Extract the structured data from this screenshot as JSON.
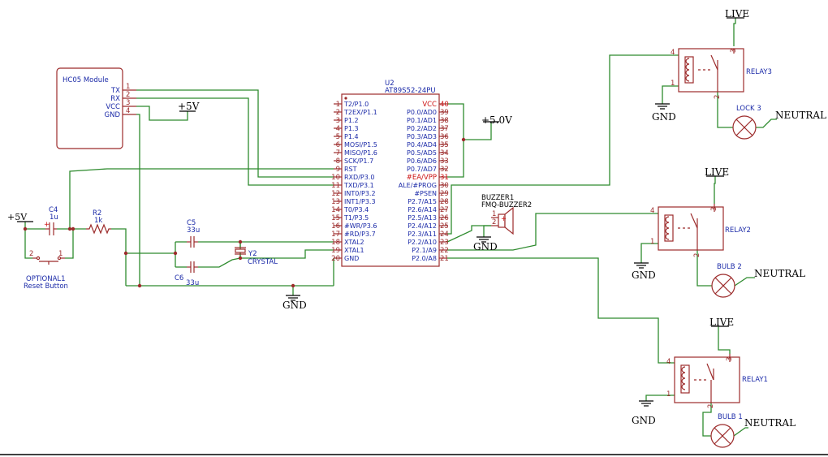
{
  "hc05": {
    "title": "HC05 Module",
    "pins": [
      "TX",
      "RX",
      "VCC",
      "GND"
    ],
    "pin_numbers": [
      "1",
      "2",
      "3",
      "4"
    ]
  },
  "mcu": {
    "ref": "U2",
    "part": "AT89S52-24PU",
    "left_pins": [
      "T2/P1.0",
      "T2EX/P1.1",
      "P1.2",
      "P1.3",
      "P1.4",
      "MOSI/P1.5",
      "MISO/P1.6",
      "SCK/P1.7",
      "RST",
      "RXD/P3.0",
      "TXD/P3.1",
      "INT0/P3.2",
      "INT1/P3.3",
      "T0/P3.4",
      "T1/P3.5",
      "#WR/P3.6",
      "#RD/P3.7",
      "XTAL2",
      "XTAL1",
      "GND"
    ],
    "left_numbers": [
      "1",
      "2",
      "3",
      "4",
      "5",
      "6",
      "7",
      "8",
      "9",
      "10",
      "11",
      "12",
      "13",
      "14",
      "15",
      "16",
      "17",
      "18",
      "19",
      "20"
    ],
    "right_pins": [
      "VCC",
      "P0.0/AD0",
      "P0.1/AD1",
      "P0.2/AD2",
      "P0.3/AD3",
      "P0.4/AD4",
      "P0.5/AD5",
      "P0.6/AD6",
      "P0.7/AD7",
      "#EA/VPP",
      "ALE/#PROG",
      "#PSEN",
      "P2.7/A15",
      "P2.6/A14",
      "P2.5/A13",
      "P2.4/A12",
      "P2.3/A11",
      "P2.2/A10",
      "P2.1/A9",
      "P2.0/A8"
    ],
    "right_numbers": [
      "40",
      "39",
      "38",
      "37",
      "36",
      "35",
      "34",
      "33",
      "32",
      "31",
      "30",
      "29",
      "28",
      "27",
      "26",
      "25",
      "24",
      "23",
      "22",
      "21"
    ]
  },
  "power": {
    "plus5v_a": "+5V",
    "plus5v_b": "+5V",
    "plus5v_c": "+5.0V",
    "gnd_main": "GND",
    "gnd_buzzer": "GND",
    "gnd_relay3": "GND",
    "gnd_relay2": "GND",
    "gnd_relay1": "GND"
  },
  "components": {
    "c4": {
      "ref": "C4",
      "value": "1u",
      "plus": "+"
    },
    "r2": {
      "ref": "R2",
      "value": "1k"
    },
    "c5": {
      "ref": "C5",
      "value": "33u"
    },
    "c6": {
      "ref": "C6",
      "value": "33u"
    },
    "y2": {
      "ref": "Y2",
      "value": "CRYSTAL"
    },
    "reset": {
      "ref": "OPTIONAL1",
      "value": "Reset Button",
      "pin_a": "2",
      "pin_b": "1"
    },
    "buzzer": {
      "ref": "BUZZER1",
      "value": "FMQ-BUZZER2",
      "pin_a": "1",
      "pin_b": "2",
      "plus": "+"
    }
  },
  "relays": [
    {
      "ref": "RELAY3",
      "load": "LOCK 3",
      "live": "LIVE",
      "neutral": "NEUTRAL",
      "gnd": "GND",
      "pins": [
        "4",
        "3",
        "1",
        "2"
      ]
    },
    {
      "ref": "RELAY2",
      "load": "BULB  2",
      "live": "LIVE",
      "neutral": "NEUTRAL",
      "gnd": "GND",
      "pins": [
        "4",
        "3",
        "1",
        "2"
      ]
    },
    {
      "ref": "RELAY1",
      "load": "BULB  1",
      "live": "LIVE",
      "neutral": "NEUTRAL",
      "gnd": "GND",
      "pins": [
        "4",
        "3",
        "1",
        "2"
      ]
    }
  ]
}
